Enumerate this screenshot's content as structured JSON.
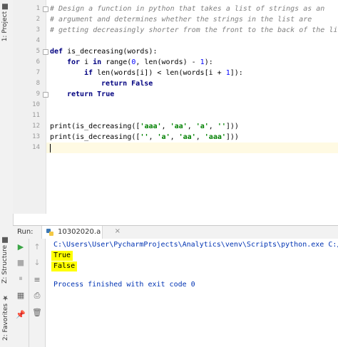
{
  "left_tabs": {
    "project": "1: Project",
    "structure": "Z: Structure",
    "favorites": "2: Favorites"
  },
  "editor": {
    "line_numbers": [
      "1",
      "2",
      "3",
      "4",
      "5",
      "6",
      "7",
      "8",
      "9",
      "10",
      "11",
      "12",
      "13",
      "14"
    ],
    "lines": {
      "l1": "# Design a function in python that takes a list of strings as an",
      "l2": "# argument and determines whether the strings in the list are",
      "l3": "# getting decreasingly shorter from the front to the back of the list",
      "l5_def": "def",
      "l5_rest": " is_decreasing(words):",
      "l6_for": "for",
      "l6_a": " i ",
      "l6_in": "in",
      "l6_b": " range(",
      "l6_n0": "0",
      "l6_c": ", len(words) - ",
      "l6_n1": "1",
      "l6_d": "):",
      "l7_if": "if",
      "l7_a": " len(words[i]) < len(words[i + ",
      "l7_n1": "1",
      "l7_b": "]):",
      "l8_return": "return",
      "l8_false": "False",
      "l9_return": "return",
      "l9_true": "True",
      "l12_a": "print(is_decreasing([",
      "l12_s1": "'aaa'",
      "l12_sep1": ", ",
      "l12_s2": "'aa'",
      "l12_sep2": ", ",
      "l12_s3": "'a'",
      "l12_sep3": ", ",
      "l12_s4": "''",
      "l12_end": "]))",
      "l13_a": "print(is_decreasing([",
      "l13_s1": "''",
      "l13_sep1": ", ",
      "l13_s2": "'a'",
      "l13_sep2": ", ",
      "l13_s3": "'aa'",
      "l13_sep3": ", ",
      "l13_s4": "'aaa'",
      "l13_end": "]))"
    }
  },
  "run_panel": {
    "label": "Run:",
    "tab_label": "10302020.a",
    "close_glyph": "×"
  },
  "console": {
    "command": "C:\\Users\\User\\PycharmProjects\\Analytics\\venv\\Scripts\\python.exe C:/Us",
    "output1": "True",
    "output2": "False",
    "finished": "Process finished with exit code 0",
    "highlight_color": "#ffff00"
  },
  "toolbar_icons": {
    "run": "▶",
    "up": "↑",
    "stop": "■",
    "down": "↓",
    "pause": "⏸",
    "wrap": "≡",
    "layout": "▦",
    "print": "⎙",
    "pin": "📌",
    "delete": "🗑"
  }
}
